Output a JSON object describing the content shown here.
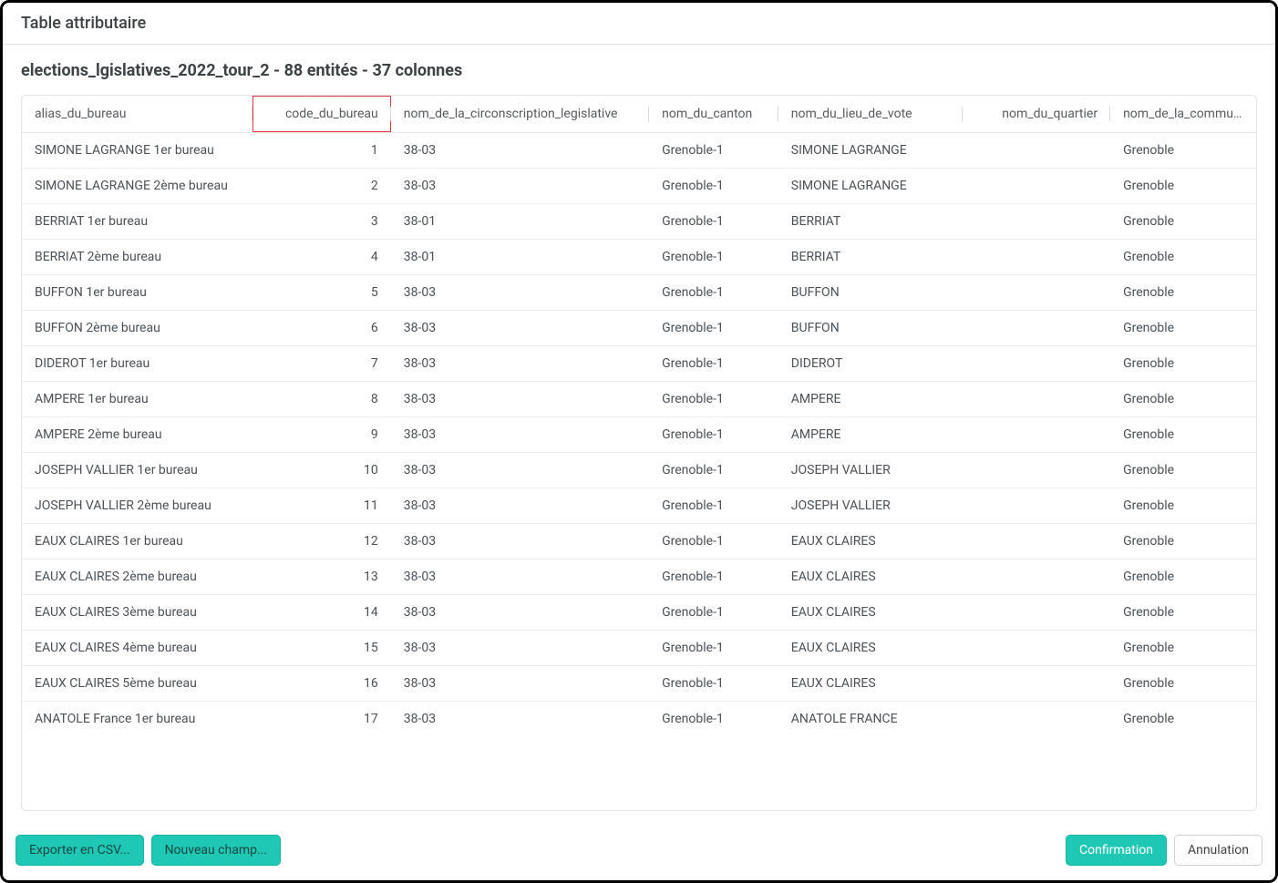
{
  "modal": {
    "title": "Table attributaire",
    "subtitle": "elections_lgislatives_2022_tour_2 - 88 entités - 37 colonnes"
  },
  "table": {
    "columns": {
      "alias": "alias_du_bureau",
      "code": "code_du_bureau",
      "circ": "nom_de_la_circonscription_legislative",
      "canton": "nom_du_canton",
      "lieu": "nom_du_lieu_de_vote",
      "quartier": "nom_du_quartier",
      "commune": "nom_de_la_commune_u"
    },
    "rows": [
      {
        "alias": "SIMONE LAGRANGE 1er bureau",
        "code": "1",
        "circ": "38-03",
        "canton": "Grenoble-1",
        "lieu": "SIMONE LAGRANGE",
        "quartier": "",
        "commune": "Grenoble"
      },
      {
        "alias": "SIMONE LAGRANGE 2ème bureau",
        "code": "2",
        "circ": "38-03",
        "canton": "Grenoble-1",
        "lieu": "SIMONE LAGRANGE",
        "quartier": "",
        "commune": "Grenoble"
      },
      {
        "alias": "BERRIAT 1er bureau",
        "code": "3",
        "circ": "38-01",
        "canton": "Grenoble-1",
        "lieu": "BERRIAT",
        "quartier": "",
        "commune": "Grenoble"
      },
      {
        "alias": "BERRIAT 2ème bureau",
        "code": "4",
        "circ": "38-01",
        "canton": "Grenoble-1",
        "lieu": "BERRIAT",
        "quartier": "",
        "commune": "Grenoble"
      },
      {
        "alias": "BUFFON 1er bureau",
        "code": "5",
        "circ": "38-03",
        "canton": "Grenoble-1",
        "lieu": "BUFFON",
        "quartier": "",
        "commune": "Grenoble"
      },
      {
        "alias": "BUFFON 2ème bureau",
        "code": "6",
        "circ": "38-03",
        "canton": "Grenoble-1",
        "lieu": "BUFFON",
        "quartier": "",
        "commune": "Grenoble"
      },
      {
        "alias": "DIDEROT 1er bureau",
        "code": "7",
        "circ": "38-03",
        "canton": "Grenoble-1",
        "lieu": "DIDEROT",
        "quartier": "",
        "commune": "Grenoble"
      },
      {
        "alias": "AMPERE 1er bureau",
        "code": "8",
        "circ": "38-03",
        "canton": "Grenoble-1",
        "lieu": "AMPERE",
        "quartier": "",
        "commune": "Grenoble"
      },
      {
        "alias": "AMPERE 2ème bureau",
        "code": "9",
        "circ": "38-03",
        "canton": "Grenoble-1",
        "lieu": "AMPERE",
        "quartier": "",
        "commune": "Grenoble"
      },
      {
        "alias": "JOSEPH VALLIER 1er bureau",
        "code": "10",
        "circ": "38-03",
        "canton": "Grenoble-1",
        "lieu": "JOSEPH VALLIER",
        "quartier": "",
        "commune": "Grenoble"
      },
      {
        "alias": "JOSEPH VALLIER 2ème bureau",
        "code": "11",
        "circ": "38-03",
        "canton": "Grenoble-1",
        "lieu": "JOSEPH VALLIER",
        "quartier": "",
        "commune": "Grenoble"
      },
      {
        "alias": "EAUX CLAIRES 1er bureau",
        "code": "12",
        "circ": "38-03",
        "canton": "Grenoble-1",
        "lieu": "EAUX CLAIRES",
        "quartier": "",
        "commune": "Grenoble"
      },
      {
        "alias": "EAUX CLAIRES 2ème bureau",
        "code": "13",
        "circ": "38-03",
        "canton": "Grenoble-1",
        "lieu": "EAUX CLAIRES",
        "quartier": "",
        "commune": "Grenoble"
      },
      {
        "alias": "EAUX CLAIRES 3ème bureau",
        "code": "14",
        "circ": "38-03",
        "canton": "Grenoble-1",
        "lieu": "EAUX CLAIRES",
        "quartier": "",
        "commune": "Grenoble"
      },
      {
        "alias": "EAUX CLAIRES 4ème bureau",
        "code": "15",
        "circ": "38-03",
        "canton": "Grenoble-1",
        "lieu": "EAUX CLAIRES",
        "quartier": "",
        "commune": "Grenoble"
      },
      {
        "alias": "EAUX CLAIRES 5ème bureau",
        "code": "16",
        "circ": "38-03",
        "canton": "Grenoble-1",
        "lieu": "EAUX CLAIRES",
        "quartier": "",
        "commune": "Grenoble"
      },
      {
        "alias": "ANATOLE France 1er bureau",
        "code": "17",
        "circ": "38-03",
        "canton": "Grenoble-1",
        "lieu": "ANATOLE FRANCE",
        "quartier": "",
        "commune": "Grenoble"
      }
    ]
  },
  "footer": {
    "export": "Exporter en CSV...",
    "newfield": "Nouveau champ...",
    "confirm": "Confirmation",
    "cancel": "Annulation"
  }
}
